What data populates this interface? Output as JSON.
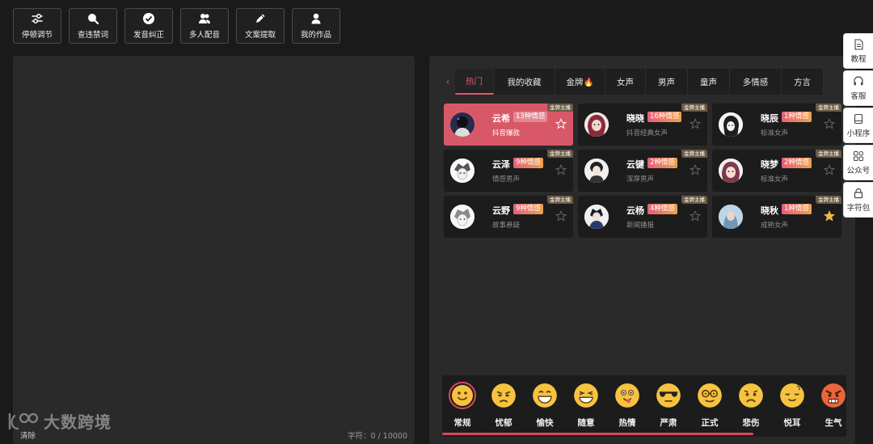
{
  "toolbar": [
    {
      "label": "停顿调节",
      "icon": "sliders-icon"
    },
    {
      "label": "查违禁词",
      "icon": "search-icon"
    },
    {
      "label": "发音纠正",
      "icon": "check-circle-icon"
    },
    {
      "label": "多人配音",
      "icon": "users-icon"
    },
    {
      "label": "文案提取",
      "icon": "pencil-icon"
    },
    {
      "label": "我的作品",
      "icon": "user-icon"
    }
  ],
  "editor": {
    "clear_label": "清除",
    "char_count": "字符：0 / 10000"
  },
  "watermark": {
    "text": "大数跨境"
  },
  "voice_tabs": {
    "prev_arrow": "‹",
    "items": [
      "热门",
      "我的收藏",
      "金牌🔥",
      "女声",
      "男声",
      "童声",
      "多情感",
      "方言"
    ],
    "active_index": 0
  },
  "voices": [
    {
      "name": "云希",
      "emotions": "13种情感",
      "desc": "抖音爆款",
      "tag": "金牌主播",
      "selected": true,
      "favorited": false
    },
    {
      "name": "晓晓",
      "emotions": "16种情感",
      "desc": "抖音经典女声",
      "tag": "金牌主播",
      "selected": false,
      "favorited": false
    },
    {
      "name": "晓辰",
      "emotions": "1种情感",
      "desc": "标准女声",
      "tag": "金牌主播",
      "selected": false,
      "favorited": false
    },
    {
      "name": "云泽",
      "emotions": "9种情感",
      "desc": "情感男声",
      "tag": "金牌主播",
      "selected": false,
      "favorited": false
    },
    {
      "name": "云键",
      "emotions": "2种情感",
      "desc": "浑厚男声",
      "tag": "金牌主播",
      "selected": false,
      "favorited": false
    },
    {
      "name": "晓梦",
      "emotions": "2种情感",
      "desc": "标准女声",
      "tag": "金牌主播",
      "selected": false,
      "favorited": false
    },
    {
      "name": "云野",
      "emotions": "9种情感",
      "desc": "故事悬疑",
      "tag": "金牌主播",
      "selected": false,
      "favorited": false
    },
    {
      "name": "云杨",
      "emotions": "4种情感",
      "desc": "新闻播报",
      "tag": "金牌主播",
      "selected": false,
      "favorited": false
    },
    {
      "name": "晓秋",
      "emotions": "1种情感",
      "desc": "成熟女声",
      "tag": "金牌主播",
      "selected": false,
      "favorited": true
    }
  ],
  "emotions": {
    "items": [
      "常规",
      "忧郁",
      "愉快",
      "随意",
      "热情",
      "严肃",
      "正式",
      "悲伤",
      "悦耳",
      "生气"
    ],
    "active_index": 0,
    "scroll_fraction": 0.77
  },
  "dock": [
    {
      "label": "教程",
      "icon": "document-icon"
    },
    {
      "label": "客服",
      "icon": "headset-icon"
    },
    {
      "label": "小程序",
      "icon": "mini-program-icon"
    },
    {
      "label": "公众号",
      "icon": "grid-icon"
    },
    {
      "label": "字符包",
      "icon": "lock-icon"
    }
  ],
  "colors": {
    "accent": "#d95868",
    "star_active": "#f0b84a"
  }
}
